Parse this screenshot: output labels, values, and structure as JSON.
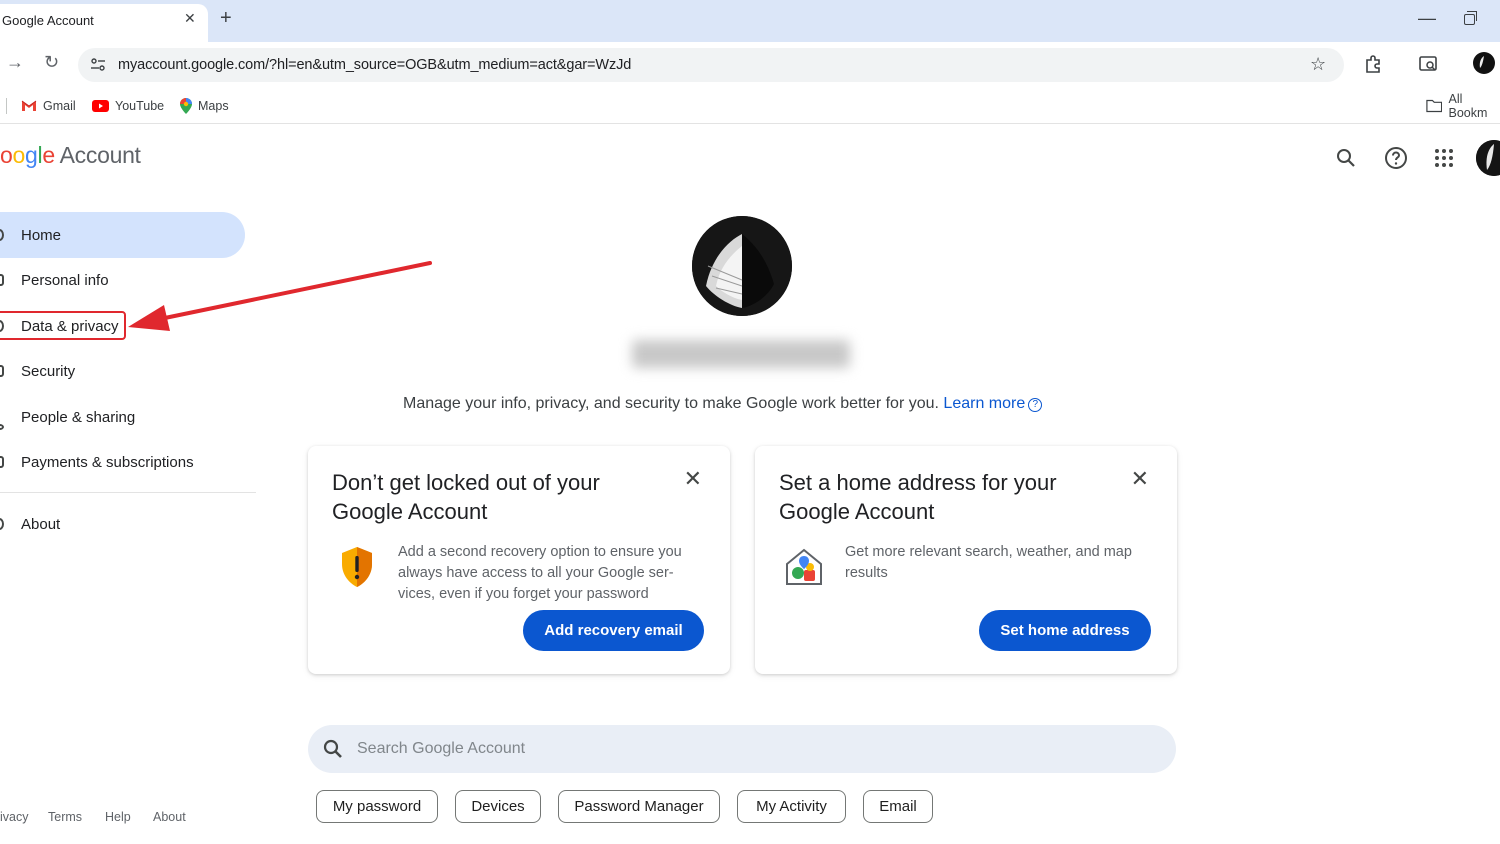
{
  "browser": {
    "tab_title": "Google Account",
    "tab_close": "✕",
    "new_tab": "+",
    "minimize": "—",
    "url": "myaccount.google.com/?hl=en&utm_source=OGB&utm_medium=act&gar=WzJd",
    "bookmarks": [
      {
        "label": "Gmail",
        "icon": "gmail-icon"
      },
      {
        "label": "YouTube",
        "icon": "youtube-icon"
      },
      {
        "label": "Maps",
        "icon": "maps-icon"
      }
    ],
    "all_bookmarks": "All Bookm"
  },
  "header": {
    "logo_letters": [
      "o",
      "o",
      "g",
      "l",
      "e"
    ],
    "logo_suffix": "Account"
  },
  "sidebar": {
    "items": [
      {
        "label": "Home",
        "active": true
      },
      {
        "label": "Personal info"
      },
      {
        "label": "Data & privacy"
      },
      {
        "label": "Security"
      },
      {
        "label": "People & sharing"
      },
      {
        "label": "Payments & subscriptions"
      },
      {
        "label": "About"
      }
    ],
    "footer": [
      "ivacy",
      "Terms",
      "Help",
      "About"
    ]
  },
  "main": {
    "intro": "Manage your info, privacy, and security to make Google work better for you.",
    "learn_more": "Learn more",
    "cards": [
      {
        "title": "Don’t get locked out of your Google Account",
        "body": "Add a second recovery option to ensure you always have access to all your Google ser-vices, even if you forget your password",
        "button": "Add recovery email",
        "icon": "shield-warning-icon"
      },
      {
        "title": "Set a home address for your Google Account",
        "body": "Get more relevant search, weather, and map results",
        "button": "Set home address",
        "icon": "home-address-icon"
      }
    ],
    "search_placeholder": "Search Google Account",
    "chips": [
      "My password",
      "Devices",
      "Password Manager",
      "My Activity",
      "Email"
    ]
  },
  "colors": {
    "accent": "#0b57d0",
    "active_nav": "#d3e3fd",
    "annotation": "#e0282e"
  }
}
